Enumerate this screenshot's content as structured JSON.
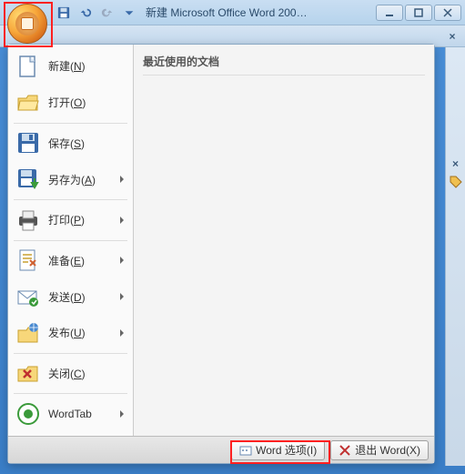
{
  "window": {
    "title": "新建 Microsoft Office Word 200…"
  },
  "office_menu": {
    "recent_header": "最近使用的文档",
    "items": [
      {
        "label": "新建(",
        "mnemonic": "N",
        "suffix": ")",
        "icon": "new-doc",
        "arrow": false
      },
      {
        "label": "打开(",
        "mnemonic": "O",
        "suffix": ")",
        "icon": "folder-open",
        "arrow": false
      },
      {
        "label": "保存(",
        "mnemonic": "S",
        "suffix": ")",
        "icon": "floppy",
        "arrow": false
      },
      {
        "label": "另存为(",
        "mnemonic": "A",
        "suffix": ")",
        "icon": "floppy-arrow",
        "arrow": true
      },
      {
        "label": "打印(",
        "mnemonic": "P",
        "suffix": ")",
        "icon": "printer",
        "arrow": true
      },
      {
        "label": "准备(",
        "mnemonic": "E",
        "suffix": ")",
        "icon": "prepare",
        "arrow": true
      },
      {
        "label": "发送(",
        "mnemonic": "D",
        "suffix": ")",
        "icon": "send",
        "arrow": true
      },
      {
        "label": "发布(",
        "mnemonic": "U",
        "suffix": ")",
        "icon": "publish",
        "arrow": true
      },
      {
        "label": "关闭(",
        "mnemonic": "C",
        "suffix": ")",
        "icon": "close-doc",
        "arrow": false
      },
      {
        "label": "WordTab",
        "mnemonic": "",
        "suffix": "",
        "icon": "wordtab",
        "arrow": true
      }
    ],
    "footer": {
      "options": "Word 选项(I)",
      "exit": "退出 Word(X)"
    }
  }
}
